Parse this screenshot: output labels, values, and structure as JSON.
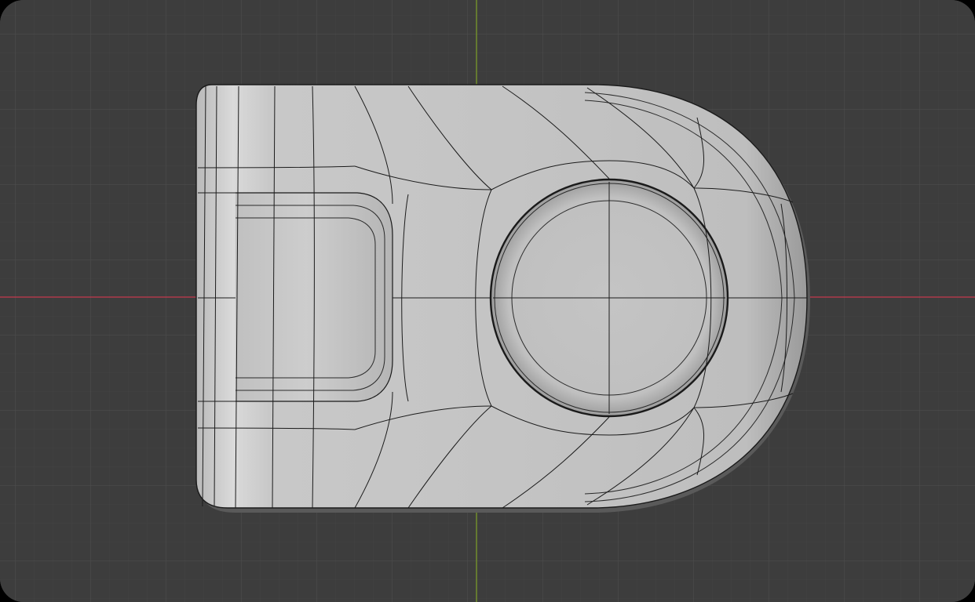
{
  "viewport": {
    "view": "top-orthographic",
    "background_color": "#3d3d3d",
    "grid": {
      "minor_color": "#444444",
      "major_color": "#4e4e4e"
    },
    "axes": {
      "x_axis_color": "#c4384e",
      "y_axis_color": "#7a9a2a"
    },
    "mesh": {
      "name": "mesh-object",
      "shading": "solid",
      "wireframe_overlay": true,
      "surface_color": "#c9c9c9",
      "edge_color": "#111111"
    }
  }
}
